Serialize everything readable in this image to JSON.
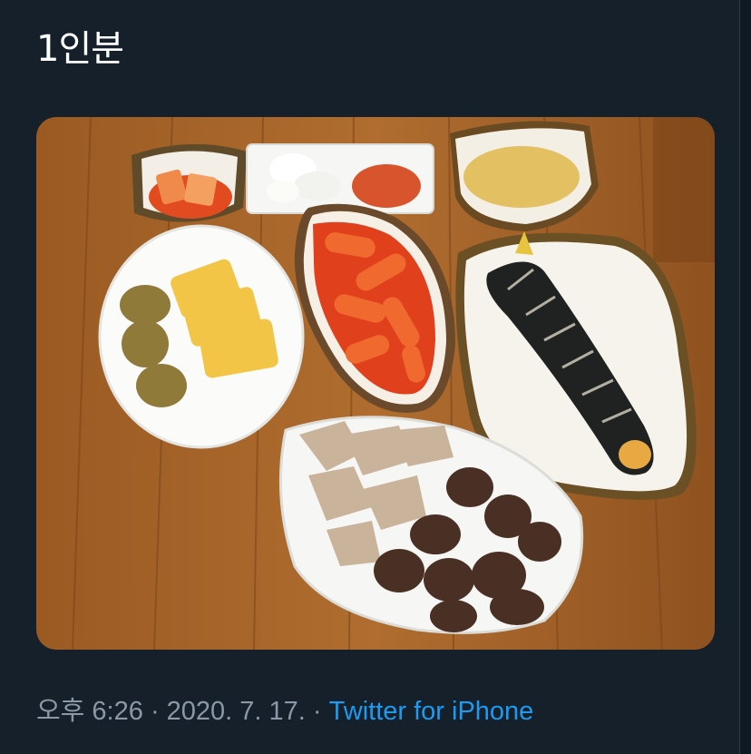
{
  "tweet": {
    "text": "1인분",
    "image_alt_icon": "food-photo",
    "meta": {
      "time": "오후 6:26",
      "separator": "·",
      "date": "2020. 7. 17.",
      "source": "Twitter for iPhone"
    }
  },
  "colors": {
    "background": "#15202b",
    "text": "#ffffff",
    "muted": "#8b98a5",
    "link": "#1d9bf0"
  }
}
